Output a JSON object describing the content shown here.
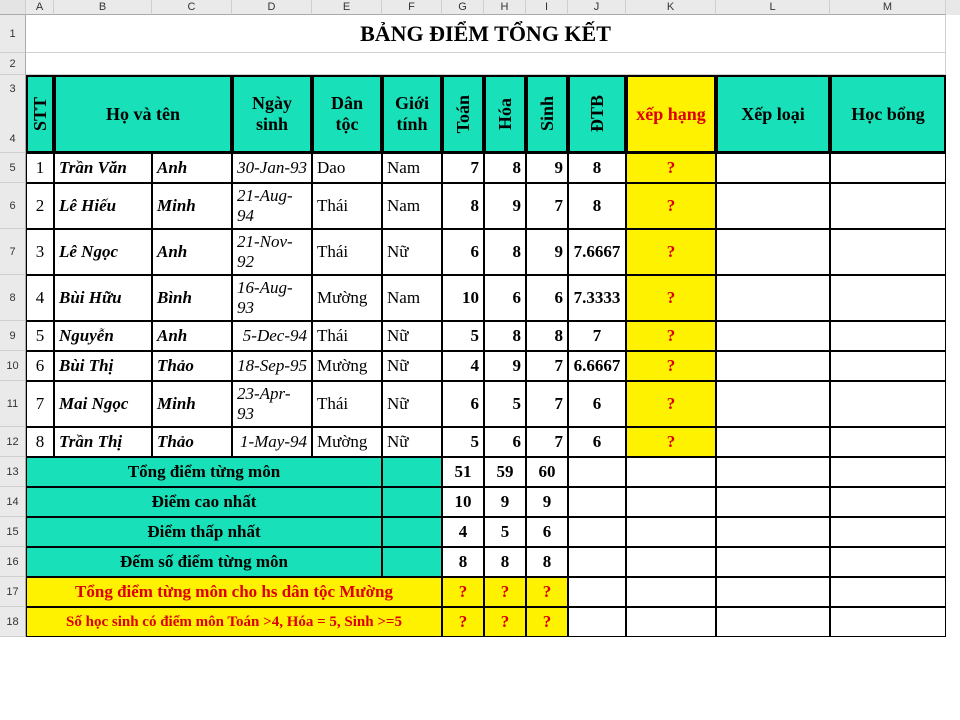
{
  "columns": [
    "",
    "A",
    "B",
    "C",
    "D",
    "E",
    "F",
    "G",
    "H",
    "I",
    "J",
    "K",
    "L",
    "M"
  ],
  "title": "BẢNG ĐIỂM TỔNG KẾT",
  "headers": {
    "stt": "STT",
    "hoten": "Họ và tên",
    "ngaysinh": "Ngày sinh",
    "dantoc": "Dân tộc",
    "gioitinh": "Giới tính",
    "toan": "Toán",
    "hoa": "Hóa",
    "sinh": "Sinh",
    "dtb": "ĐTB",
    "xephang": "xếp hạng",
    "xeploai": "Xếp loại",
    "hocbong": "Học bổng"
  },
  "rows": [
    {
      "n": "1",
      "ln": "Trần Văn",
      "fn": "Anh",
      "dob": "30-Jan-93",
      "eth": "Dao",
      "sex": "Nam",
      "toan": "7",
      "hoa": "8",
      "sinh": "9",
      "dtb": "8",
      "rank": "?"
    },
    {
      "n": "2",
      "ln": "Lê Hiếu",
      "fn": "Minh",
      "dob": "21-Aug-94",
      "eth": "Thái",
      "sex": "Nam",
      "toan": "8",
      "hoa": "9",
      "sinh": "7",
      "dtb": "8",
      "rank": "?"
    },
    {
      "n": "3",
      "ln": "Lê Ngọc",
      "fn": "Anh",
      "dob": "21-Nov-92",
      "eth": "Thái",
      "sex": "Nữ",
      "toan": "6",
      "hoa": "8",
      "sinh": "9",
      "dtb": "7.6667",
      "rank": "?"
    },
    {
      "n": "4",
      "ln": "Bùi Hữu",
      "fn": "Bình",
      "dob": "16-Aug-93",
      "eth": "Mường",
      "sex": "Nam",
      "toan": "10",
      "hoa": "6",
      "sinh": "6",
      "dtb": "7.3333",
      "rank": "?"
    },
    {
      "n": "5",
      "ln": "Nguyễn",
      "fn": "Anh",
      "dob": "5-Dec-94",
      "eth": "Thái",
      "sex": "Nữ",
      "toan": "5",
      "hoa": "8",
      "sinh": "8",
      "dtb": "7",
      "rank": "?"
    },
    {
      "n": "6",
      "ln": "Bùi Thị",
      "fn": "Thảo",
      "dob": "18-Sep-95",
      "eth": "Mường",
      "sex": "Nữ",
      "toan": "4",
      "hoa": "9",
      "sinh": "7",
      "dtb": "6.6667",
      "rank": "?"
    },
    {
      "n": "7",
      "ln": "Mai Ngọc",
      "fn": "Minh",
      "dob": "23-Apr-93",
      "eth": "Thái",
      "sex": "Nữ",
      "toan": "6",
      "hoa": "5",
      "sinh": "7",
      "dtb": "6",
      "rank": "?"
    },
    {
      "n": "8",
      "ln": "Trần Thị",
      "fn": "Thảo",
      "dob": "1-May-94",
      "eth": "Mường",
      "sex": "Nữ",
      "toan": "5",
      "hoa": "6",
      "sinh": "7",
      "dtb": "6",
      "rank": "?"
    }
  ],
  "summary": {
    "tong": {
      "label": "Tổng điểm từng môn",
      "toan": "51",
      "hoa": "59",
      "sinh": "60"
    },
    "max": {
      "label": "Điểm cao nhất",
      "toan": "10",
      "hoa": "9",
      "sinh": "9"
    },
    "min": {
      "label": "Điểm thấp nhất",
      "toan": "4",
      "hoa": "5",
      "sinh": "6"
    },
    "count": {
      "label": "Đếm số điểm từng môn",
      "toan": "8",
      "hoa": "8",
      "sinh": "8"
    },
    "muong": {
      "label": "Tổng điểm từng môn cho hs dân tộc Mường",
      "toan": "?",
      "hoa": "?",
      "sinh": "?"
    },
    "cond": {
      "label": "Số học sinh có điểm môn Toán >4, Hóa = 5, Sinh >=5",
      "toan": "?",
      "hoa": "?",
      "sinh": "?"
    }
  }
}
